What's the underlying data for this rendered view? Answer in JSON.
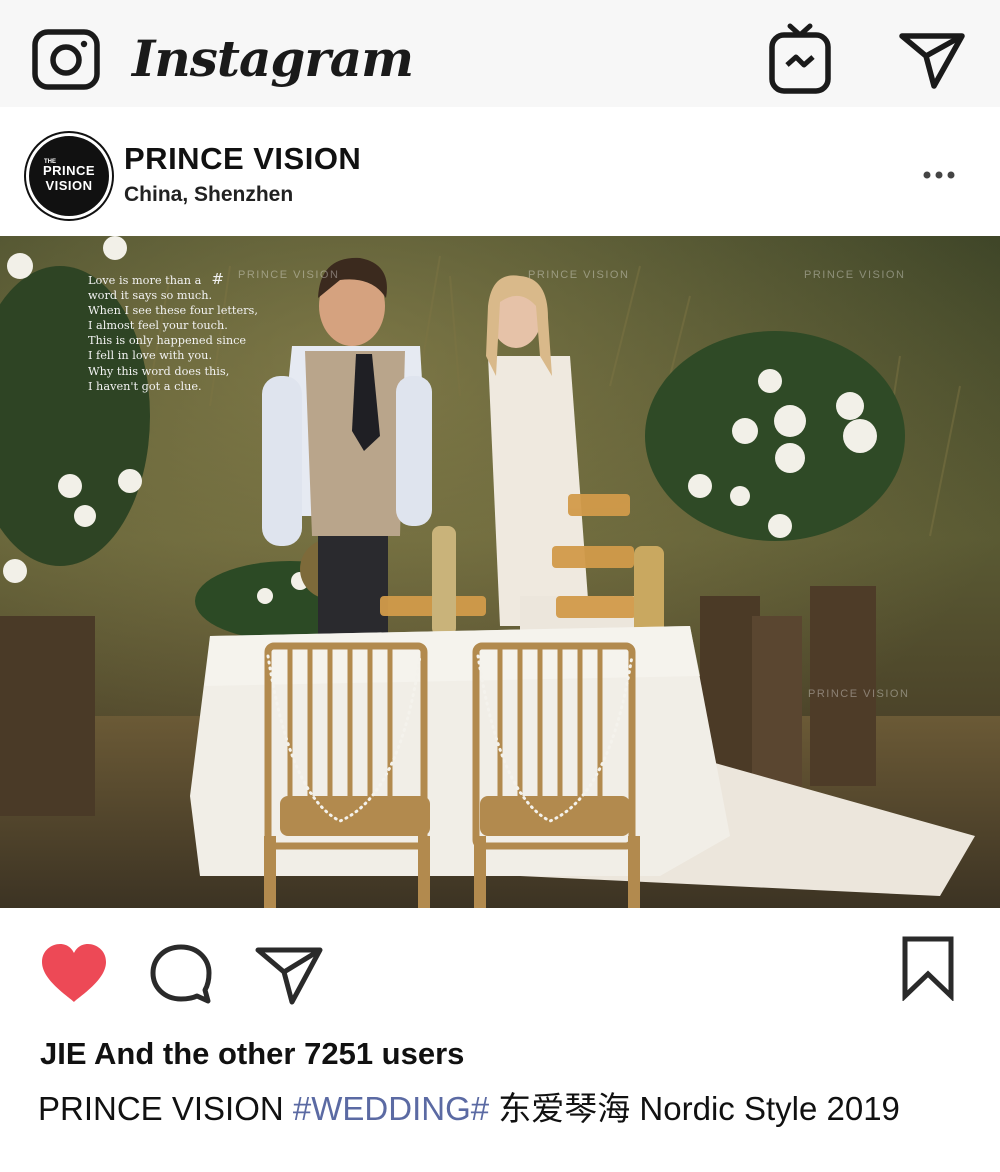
{
  "app": {
    "brand": "Instagram",
    "icons": {
      "camera": "camera-icon",
      "igtv": "igtv-icon",
      "direct": "direct-message-icon"
    }
  },
  "post_header": {
    "avatar_small": "THE",
    "avatar_line1": "PRINCE",
    "avatar_line2": "VISION",
    "username": "PRINCE VISION",
    "location": "China, Shenzhen",
    "more_icon": "more-options-icon"
  },
  "photo": {
    "poem_lines": [
      "Love is more than a",
      "word it says so much.",
      "When I see these four letters,",
      "I almost feel your touch.",
      "This is only happened since",
      "I fell in love with you.",
      "Why this word does this,",
      "I haven't got a clue."
    ],
    "poem_hash": "#",
    "watermark": "PRINCE VISION"
  },
  "actions": {
    "like_icon": "heart-icon",
    "comment_icon": "comment-icon",
    "share_icon": "share-icon",
    "save_icon": "bookmark-icon",
    "like_color": "#ed4956"
  },
  "caption": {
    "likes_text": "JIE And the other 7251 users",
    "author": "PRINCE VISION",
    "hashtag": "#WEDDING#",
    "text": "东爱琴海 Nordic Style 2019"
  }
}
